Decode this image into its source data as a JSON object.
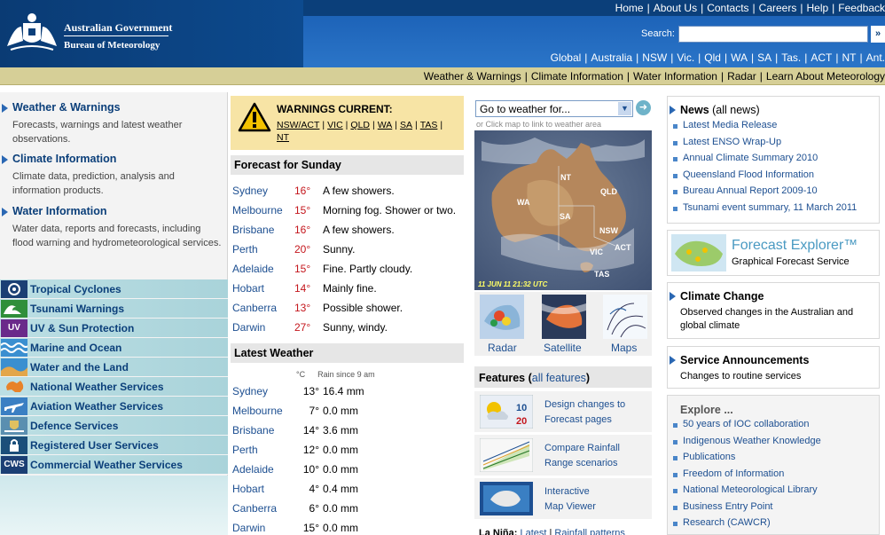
{
  "header": {
    "gov_name": "Australian Government",
    "bureau_name": "Bureau of Meteorology",
    "top_links": [
      "Home",
      "About Us",
      "Contacts",
      "Careers",
      "Help",
      "Feedback"
    ],
    "search_label": "Search:",
    "search_value": "",
    "search_go": "»",
    "regions": [
      "Global",
      "Australia",
      "NSW",
      "Vic.",
      "Qld",
      "WA",
      "SA",
      "Tas.",
      "ACT",
      "NT",
      "Ant."
    ]
  },
  "nav": {
    "items": [
      "Weather & Warnings",
      "Climate Information",
      "Water Information",
      "Radar",
      "Learn About Meteorology"
    ]
  },
  "left": {
    "sections": [
      {
        "title": "Weather & Warnings",
        "desc": "Forecasts, warnings and latest weather observations."
      },
      {
        "title": "Climate Information",
        "desc": "Climate data, prediction, analysis and information products."
      },
      {
        "title": "Water Information",
        "desc": "Water data, reports and forecasts, including flood warning and hydrometeorological services."
      }
    ],
    "quicklinks": [
      {
        "label": "Tropical Cyclones",
        "icon": "cyclone-icon"
      },
      {
        "label": "Tsunami Warnings",
        "icon": "tsunami-icon"
      },
      {
        "label": "UV & Sun Protection",
        "icon": "uv-icon",
        "icon_text": "UV"
      },
      {
        "label": "Marine and Ocean",
        "icon": "waves-icon"
      },
      {
        "label": "Water and the Land",
        "icon": "water-land-icon"
      },
      {
        "label": "National Weather Services",
        "icon": "australia-map-icon"
      },
      {
        "label": "Aviation Weather Services",
        "icon": "plane-icon"
      },
      {
        "label": "Defence Services",
        "icon": "defence-crest-icon"
      },
      {
        "label": "Registered User Services",
        "icon": "lock-icon"
      },
      {
        "label": "Commercial Weather Services",
        "icon": "cws-icon",
        "icon_text": "CWS"
      }
    ]
  },
  "warnings": {
    "title": "WARNINGS CURRENT:",
    "links": [
      "NSW/ACT",
      "VIC",
      "QLD",
      "WA",
      "SA",
      "TAS",
      "NT"
    ]
  },
  "forecast": {
    "title": "Forecast for Sunday",
    "rows": [
      {
        "city": "Sydney",
        "temp": "16°",
        "desc": "A few showers."
      },
      {
        "city": "Melbourne",
        "temp": "15°",
        "desc": "Morning fog. Shower or two."
      },
      {
        "city": "Brisbane",
        "temp": "16°",
        "desc": "A few showers."
      },
      {
        "city": "Perth",
        "temp": "20°",
        "desc": "Sunny."
      },
      {
        "city": "Adelaide",
        "temp": "15°",
        "desc": "Fine. Partly cloudy."
      },
      {
        "city": "Hobart",
        "temp": "14°",
        "desc": "Mainly fine."
      },
      {
        "city": "Canberra",
        "temp": "13°",
        "desc": "Possible shower."
      },
      {
        "city": "Darwin",
        "temp": "27°",
        "desc": "Sunny, windy."
      }
    ]
  },
  "latest": {
    "title": "Latest Weather",
    "col_temp": "°C",
    "col_rain": "Rain since 9 am",
    "rows": [
      {
        "city": "Sydney",
        "temp": "13°",
        "rain": "16.4 mm"
      },
      {
        "city": "Melbourne",
        "temp": "7°",
        "rain": "0.0 mm"
      },
      {
        "city": "Brisbane",
        "temp": "14°",
        "rain": "3.6 mm"
      },
      {
        "city": "Perth",
        "temp": "12°",
        "rain": "0.0 mm"
      },
      {
        "city": "Adelaide",
        "temp": "10°",
        "rain": "0.0 mm"
      },
      {
        "city": "Hobart",
        "temp": "4°",
        "rain": "0.4 mm"
      },
      {
        "city": "Canberra",
        "temp": "6°",
        "rain": "0.0 mm"
      },
      {
        "city": "Darwin",
        "temp": "15°",
        "rain": "0.0 mm"
      }
    ]
  },
  "map": {
    "goto_value": "Go to weather for...",
    "hint": "or Click map to link to weather area",
    "timestamp": "11 JUN 11 21:32 UTC",
    "states": [
      "NT",
      "QLD",
      "WA",
      "SA",
      "NSW",
      "ACT",
      "VIC",
      "TAS"
    ],
    "thumbs": [
      "Radar",
      "Satellite",
      "Maps"
    ]
  },
  "features": {
    "title": "Features",
    "all_label": "all features",
    "items": [
      {
        "line1": "Design changes to",
        "line2": "Forecast pages"
      },
      {
        "line1": "Compare Rainfall",
        "line2": "Range scenarios"
      },
      {
        "line1": "Interactive",
        "line2": "Map Viewer"
      }
    ],
    "icon_numbers": [
      "10",
      "20"
    ],
    "lanina_label": "La Niña:",
    "lanina_links": [
      "Latest",
      "Rainfall patterns"
    ]
  },
  "news": {
    "title": "News",
    "all_label": "(all news)",
    "items": [
      "Latest Media Release",
      "Latest ENSO Wrap-Up",
      "Annual Climate Summary 2010",
      "Queensland Flood Information",
      "Bureau Annual Report 2009-10",
      "Tsunami event summary, 11 March 2011"
    ]
  },
  "forecast_explorer": {
    "title": "Forecast Explorer™",
    "subtitle": "Graphical Forecast Service"
  },
  "climate_change": {
    "title": "Climate Change",
    "desc": "Observed changes in the Australian and global climate"
  },
  "service_ann": {
    "title": "Service Announcements",
    "desc": "Changes to routine services"
  },
  "explore": {
    "title": "Explore ...",
    "items": [
      "50 years of IOC collaboration",
      "Indigenous Weather Knowledge",
      "Publications",
      "Freedom of Information",
      "National Meteorological Library",
      "Business Entry Point",
      "Research (CAWCR)"
    ]
  },
  "colors": {
    "header_blue": "#0b3f7a",
    "nav_tan": "#d6cf97",
    "link_blue": "#1d4f91",
    "temp_red": "#c4161c",
    "warning_yellow": "#f7e4a5"
  }
}
